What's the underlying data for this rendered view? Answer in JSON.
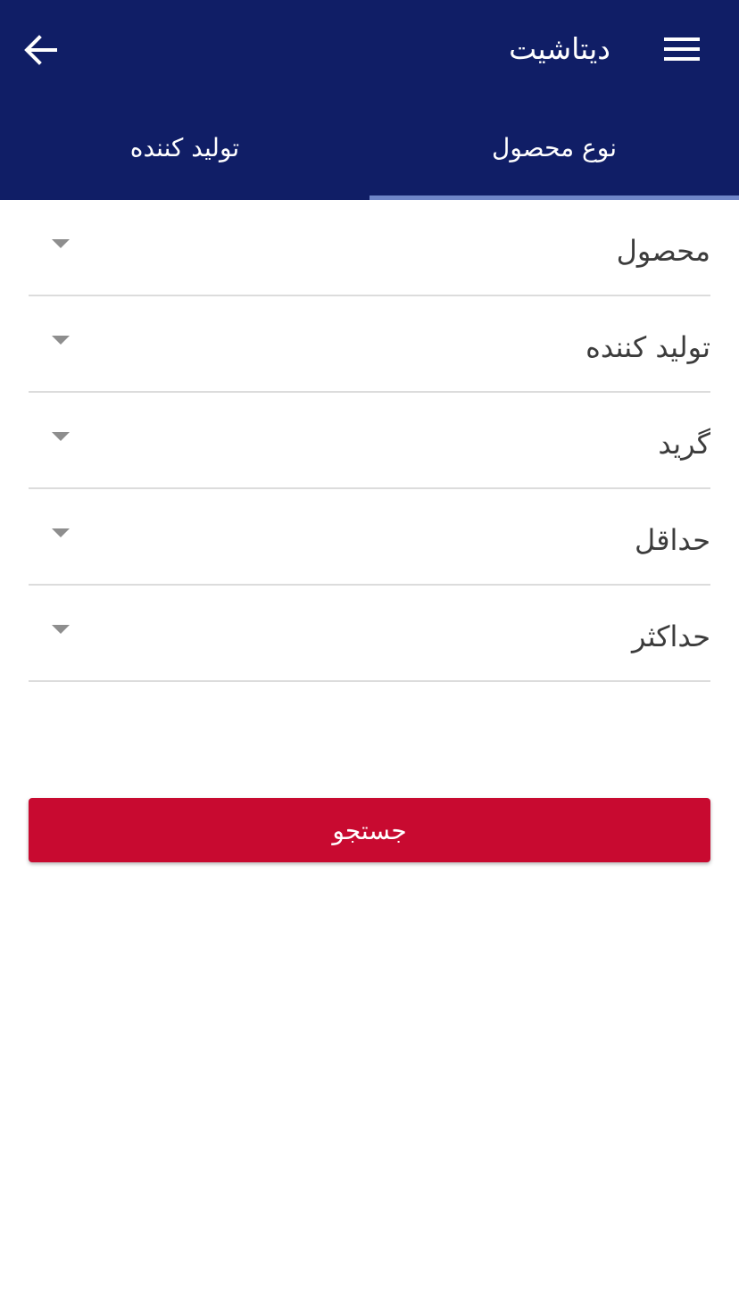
{
  "header": {
    "title": "دیتاشیت",
    "menu_icon": "hamburger-menu-icon",
    "back_icon": "arrow-left-icon",
    "background_color": "#101e66"
  },
  "tabs": [
    {
      "label": "نوع محصول",
      "active": true
    },
    {
      "label": "تولید کننده",
      "active": false
    }
  ],
  "filters": [
    {
      "label": "محصول"
    },
    {
      "label": "تولید کننده"
    },
    {
      "label": "گرید"
    },
    {
      "label": "حداقل"
    },
    {
      "label": "حداکثر"
    }
  ],
  "search_button": {
    "label": "جستجو",
    "color": "#c80a30"
  }
}
